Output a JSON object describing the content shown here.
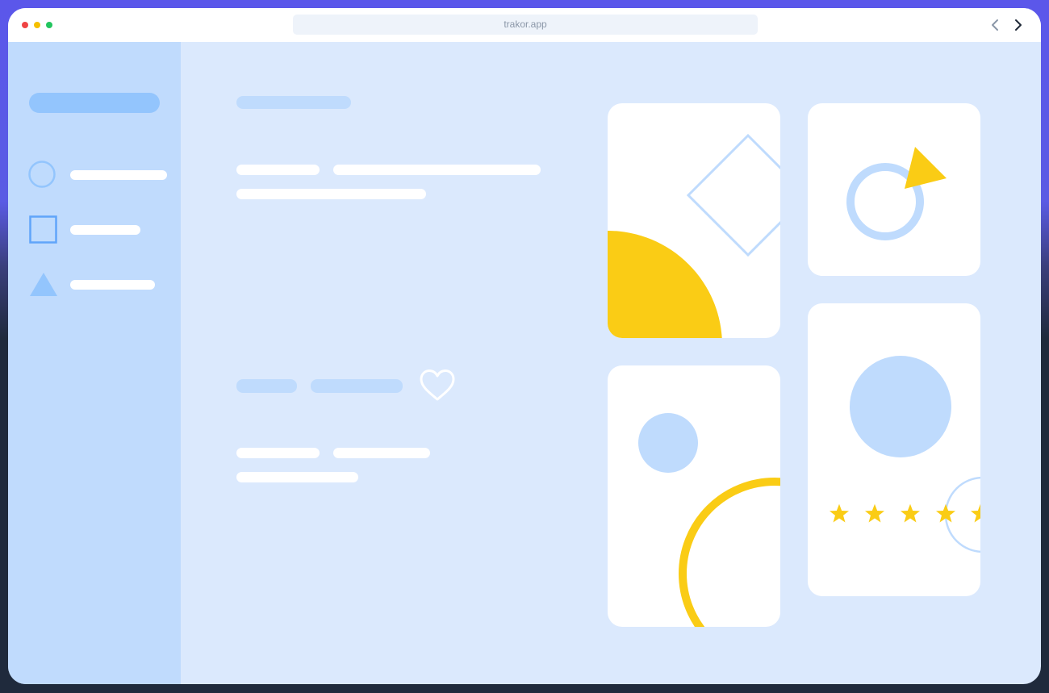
{
  "browser": {
    "url": "trakor.app",
    "controls": [
      "close-dot",
      "minimize-dot",
      "maximize-dot"
    ],
    "back_icon": "chevron-left-icon",
    "forward_icon": "chevron-right-icon"
  },
  "sidebar": {
    "items": [
      {
        "icon": "circle-icon"
      },
      {
        "icon": "square-icon"
      },
      {
        "icon": "triangle-icon"
      }
    ]
  },
  "content": {
    "favorite_icon": "heart-icon"
  },
  "cards": [
    {
      "shapes": [
        "diamond-outline",
        "yellow-quarter-circle"
      ]
    },
    {
      "shapes": [
        "ring",
        "yellow-triangle"
      ]
    },
    {
      "shapes": [
        "blue-circle",
        "yellow-ring"
      ]
    },
    {
      "shapes": [
        "blue-circle",
        "circle-outline"
      ],
      "rating": 5
    }
  ],
  "colors": {
    "frame_outline": "#5b57ea",
    "page_background": "#dbe9fd",
    "sidebar_background": "#c0dbfd",
    "accent_blue": "#93c5fd",
    "accent_yellow": "#facc15",
    "light_blue": "#bfdbfd"
  }
}
